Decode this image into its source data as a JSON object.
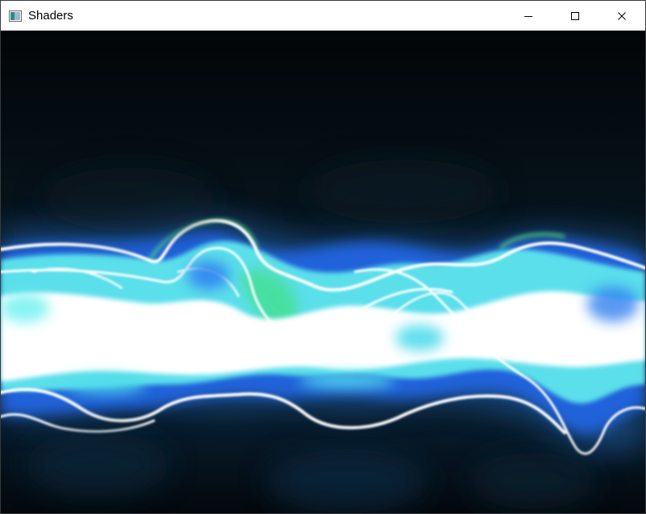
{
  "window": {
    "title": "Shaders",
    "icons": {
      "app": "app-window-icon",
      "minimize": "minimize-icon",
      "maximize": "maximize-icon",
      "close": "close-icon"
    }
  },
  "canvas": {
    "description_colors": {
      "background": "#03070a",
      "core": "#ffffff",
      "cyan": "#5ef0f0",
      "blue": "#2a6cf0",
      "green": "#3ee07a"
    }
  }
}
